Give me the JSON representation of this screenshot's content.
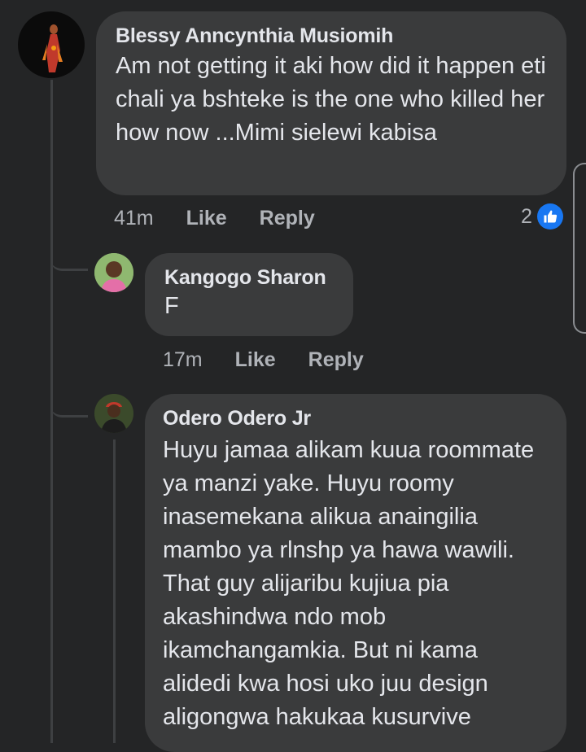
{
  "comments": [
    {
      "author": "Blessy Anncynthia Musiomih",
      "text": "Am not getting it aki how did it happen eti chali ya bshteke is the one who killed her how now ...Mimi sielewi kabisa",
      "time": "41m",
      "like_label": "Like",
      "reply_label": "Reply",
      "reaction_count": "2",
      "reaction_icon": "thumbs-up-icon",
      "replies": [
        {
          "author": "Kangogo Sharon",
          "text": "F",
          "time": "17m",
          "like_label": "Like",
          "reply_label": "Reply"
        },
        {
          "author": "Odero Odero Jr",
          "text": "Huyu jamaa alikam kuua roommate ya manzi yake. Huyu roomy inasemekana alikua anaingilia mambo ya rlnshp ya hawa wawili. That guy alijaribu kujiua pia akashindwa ndo mob ikamchangamkia. But ni kama alidedi kwa hosi uko juu design aligongwa hakukaa kusurvive"
        }
      ]
    }
  ],
  "colors": {
    "background": "#242526",
    "bubble": "#3a3b3c",
    "text": "#e4e6eb",
    "secondary_text": "#b0b3b8",
    "like_blue": "#1877f2"
  }
}
